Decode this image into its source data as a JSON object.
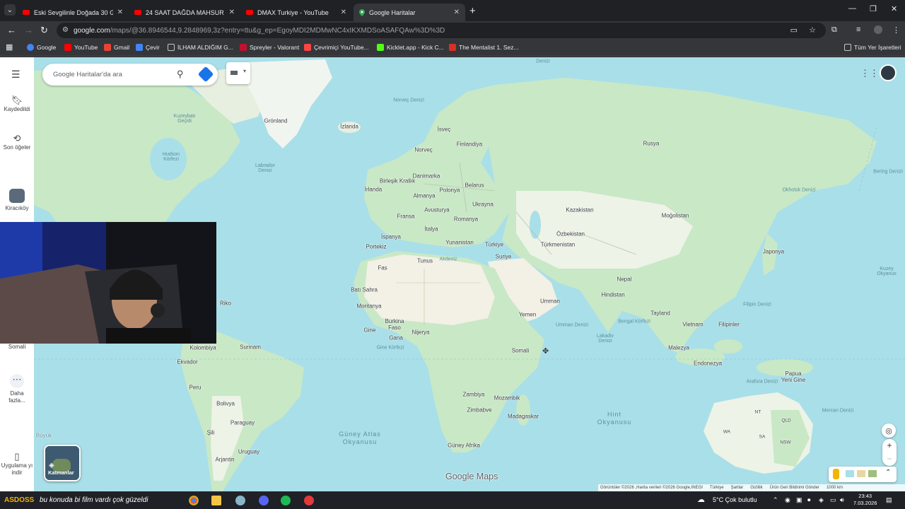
{
  "browser": {
    "tabs": [
      {
        "title": "Eski Sevgilinle Doğada 30 Gün H",
        "favicon": "youtube-icon",
        "active": false
      },
      {
        "title": "24 SAAT DAĞDA MAHSUR KALD",
        "favicon": "youtube-icon",
        "active": false
      },
      {
        "title": "DMAX Turkiye - YouTube",
        "favicon": "youtube-icon",
        "active": false
      },
      {
        "title": "Google Haritalar",
        "favicon": "google-maps-icon",
        "active": true
      }
    ],
    "url_host": "google.com",
    "url_path": "/maps/@36.8946544,9.2848969,3z?entry=ttu&g_ep=EgoyMDI2MDMwNC4xIKXMDSoASAFQAw%3D%3D",
    "bookmarks": [
      {
        "label": "Google",
        "color": "#4285f4"
      },
      {
        "label": "YouTube",
        "color": "#ff0000"
      },
      {
        "label": "Gmail",
        "color": "#ea4335"
      },
      {
        "label": "Çevir",
        "color": "#4285f4"
      },
      {
        "label": "İLHAM ALDIĞIM G...",
        "color": "#9aa0a6"
      },
      {
        "label": "Spreyler - Valorant",
        "color": "#c3102f"
      },
      {
        "label": "Çevrimiçi YouTube...",
        "color": "#ff4444"
      },
      {
        "label": "Kicklet.app - Kick C...",
        "color": "#53fc18"
      },
      {
        "label": "The Mentalist 1. Sez...",
        "color": "#d93025"
      }
    ],
    "all_bookmarks": "Tüm Yer İşaretleri"
  },
  "sidebar": {
    "items": [
      {
        "label": "Kaydedildi",
        "icon": "bookmark-icon"
      },
      {
        "label": "Son öğeler",
        "icon": "history-icon"
      },
      {
        "label": "Kiracıköy",
        "icon": "place-thumbnail"
      },
      {
        "label": "Somali",
        "icon": "place-thumbnail"
      },
      {
        "label": "Daha fazla...",
        "icon": "more-icon"
      },
      {
        "label": "Uygulama yı indir",
        "icon": "phone-icon"
      }
    ]
  },
  "search": {
    "placeholder": "Google Haritalar'da ara"
  },
  "map": {
    "labels": {
      "gronland": "Grönland",
      "izlanda": "İzlanda",
      "isvec": "İsveç",
      "norvec": "Norveç",
      "finlandiya": "Finlandiya",
      "rusya": "Rusya",
      "birlesik_krallik": "Birleşik Krallık",
      "danimarka": "Danimarka",
      "irlanda": "İrlanda",
      "almanya": "Almanya",
      "polonya": "Polonya",
      "belarus": "Belarus",
      "ukrayna": "Ukrayna",
      "fransa": "Fransa",
      "avusturya": "Avusturya",
      "romanya": "Romanya",
      "italya": "İtalya",
      "ispanya": "İspanya",
      "portekiz": "Portekiz",
      "yunanistan": "Yunanistan",
      "turkiye": "Türkiye",
      "kazakistan": "Kazakistan",
      "ozbekistan": "Özbekistan",
      "turkmenistan": "Türkmenistan",
      "mogolistan": "Moğolistan",
      "japonya": "Japonya",
      "tunus": "Tunus",
      "suriye": "Suriye",
      "fas": "Fas",
      "nepal": "Nepal",
      "hindistan": "Hindistan",
      "bati_sahra": "Batı Sahra",
      "umman": "Umman",
      "moritanya": "Moritanya",
      "yemen": "Yemen",
      "tayland": "Tayland",
      "vietnam": "Vietnam",
      "filipinler": "Filipinler",
      "burkina_faso": "Burkina Faso",
      "gine": "Gine",
      "nijerya": "Nijerya",
      "gana": "Gana",
      "somali": "Somali",
      "malezya": "Malezya",
      "endonezya": "Endonezya",
      "papua": "Papua Yeni Gine",
      "kolombiya": "Kolombiya",
      "surinam": "Surinam",
      "ekvador": "Ekvador",
      "peru": "Peru",
      "bolivya": "Bolivya",
      "paraguay": "Paraguay",
      "sili": "Şili",
      "uruguay": "Uruguay",
      "arjantin": "Arjantin",
      "zambiya": "Zambiya",
      "mozambik": "Mozambik",
      "zimbabve": "Zimbabve",
      "madagaskar": "Madagaskar",
      "guney_afrika": "Güney Afrika",
      "riko": "Riko",
      "nt": "NT",
      "wa": "WA",
      "qld": "QLD",
      "sa": "SA",
      "nsw": "NSW"
    },
    "ocean_labels": {
      "guney_atlas": "Güney Atlas Okyanusu",
      "hint": "Hint Okyanusu",
      "norvec_denizi": "Norveç Denizi",
      "kuzey_okyanus": "Kuzey Okyanus",
      "labrador": "Labrador Denizi",
      "hudson": "Hudson Körfezi",
      "bering": "Bering Denizi",
      "okhotsk": "Okhotsk Denizi",
      "umman_denizi": "Umman Denizi",
      "bengal": "Bengal Körfezi",
      "filipin": "Filipin Denizi",
      "mercan": "Mercan Denizi",
      "arafura": "Arafura Denizi",
      "akdeniz": "Akdeniz",
      "gine_korfezi": "Gine Körfezi",
      "lakadiv": "Lakadiv Denizi",
      "kuzey_bati": "Kuzeybatı Geçidi",
      "kara": "Denizi",
      "buyuk": "Büyük"
    },
    "attribution": [
      "Görüntüler ©2026 ,Harita verileri ©2026 Google,INEGI",
      "Türkiye",
      "Şartlar",
      "Gizlilik",
      "Ürün Geri Bildirimi Gönder",
      "1000 km"
    ],
    "logo": "Google Maps",
    "layers_label": "Katmanlar"
  },
  "taskbar": {
    "ticker": "bu konuda bi film vardı çok güzeldi",
    "weather": "5°C  Çok bulutlu",
    "time": "23:43",
    "date": "7.03.2026"
  },
  "colors": {
    "water": "#a9dfe8",
    "land_green": "#c7e9c6",
    "land_light": "#edf3e6",
    "desert": "#f3f0e5",
    "accent_blue": "#1a73e8"
  }
}
